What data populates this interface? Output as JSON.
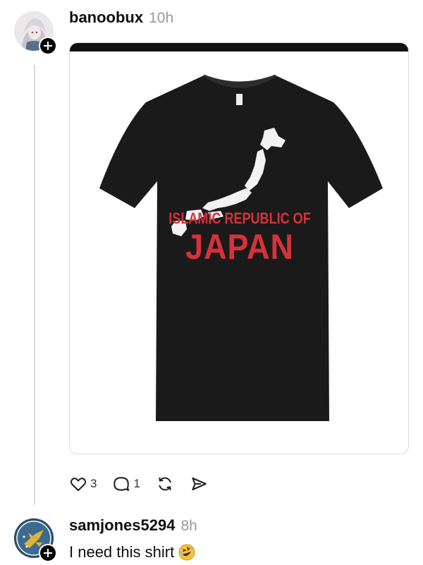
{
  "post": {
    "author": "banoobux",
    "time": "10h",
    "image": {
      "shirt_line1": "ISLAMIC REPUBLIC OF",
      "shirt_line2": "JAPAN",
      "shirt_color": "#1a1a1a",
      "text_color": "#d6323a"
    },
    "actions": {
      "likes": "3",
      "replies": "1",
      "repost_icon": "repost-icon",
      "share_icon": "share-icon"
    }
  },
  "reply": {
    "author": "samjones5294",
    "time": "8h",
    "text": "I need this shirt",
    "emoji_icon": "rolling-on-floor-laughing-emoji"
  },
  "colors": {
    "thread_line": "#d9d9d9",
    "muted": "#999999",
    "text": "#101010"
  }
}
